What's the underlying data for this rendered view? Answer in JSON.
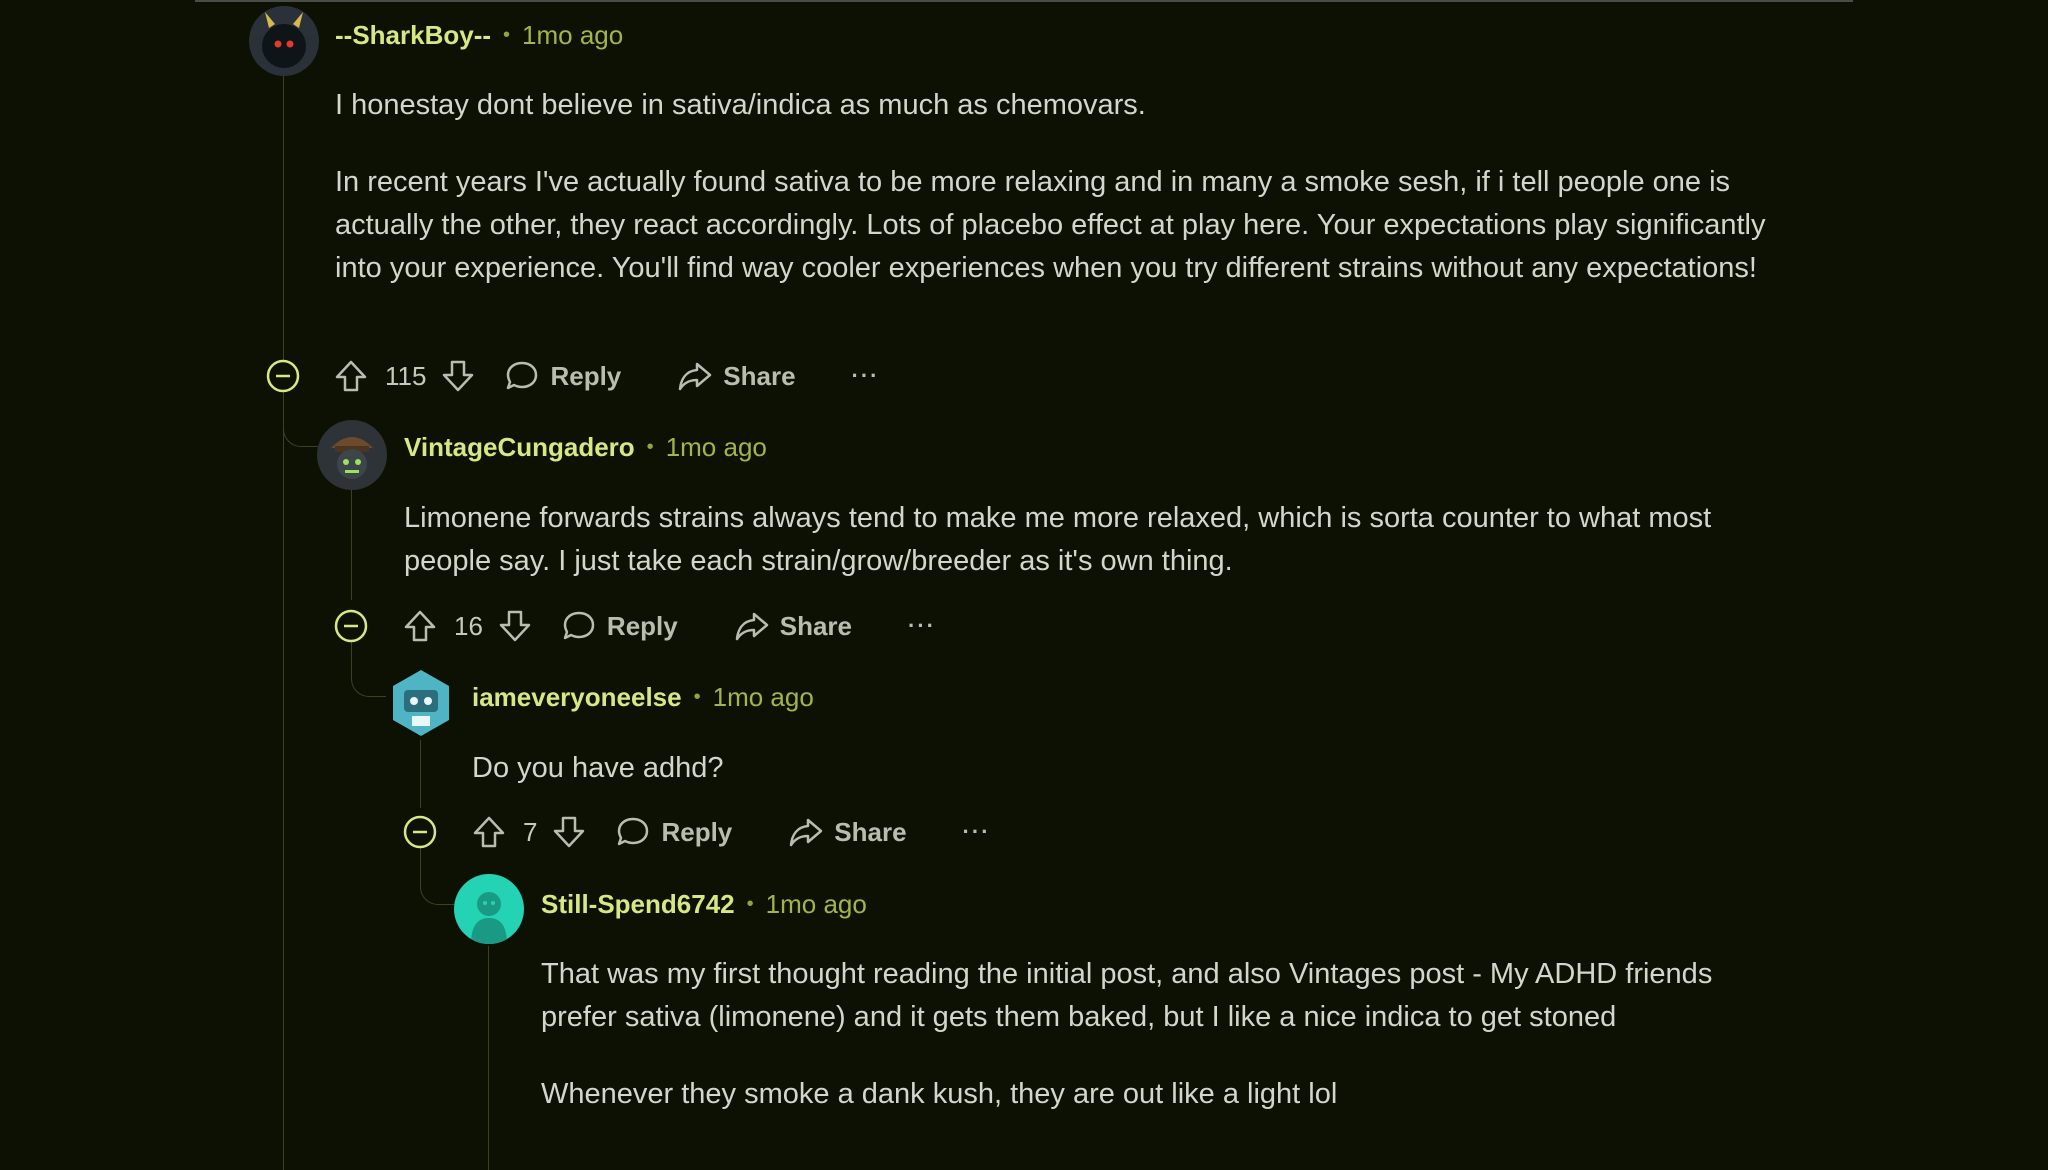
{
  "comments": [
    {
      "username": "--SharkBoy--",
      "time": "1mo ago",
      "paragraphs": [
        "I honestay dont believe in sativa/indica as much as chemovars.",
        "In recent years I've actually found sativa to be more relaxing and in many a smoke sesh, if i tell people one is actually the other, they react accordingly. Lots of placebo effect at play here. Your expectations play significantly into your experience. You'll find way cooler experiences when you try different strains without any expectations!"
      ],
      "score": "115",
      "reply_label": "Reply",
      "share_label": "Share",
      "more_label": "···"
    },
    {
      "username": "VintageCungadero",
      "time": "1mo ago",
      "paragraphs": [
        "Limonene forwards strains always tend to make me more relaxed, which is sorta counter to what most people say. I just take each strain/grow/breeder as it's own thing."
      ],
      "score": "16",
      "reply_label": "Reply",
      "share_label": "Share",
      "more_label": "···"
    },
    {
      "username": "iameveryoneelse",
      "time": "1mo ago",
      "paragraphs": [
        "Do you have adhd?"
      ],
      "score": "7",
      "reply_label": "Reply",
      "share_label": "Share",
      "more_label": "···"
    },
    {
      "username": "Still-Spend6742",
      "time": "1mo ago",
      "paragraphs": [
        "That was my first thought reading the initial post, and also Vintages post - My ADHD friends prefer sativa (limonene) and it gets them baked, but I like a nice indica to get stoned",
        "Whenever they smoke a dank kush, they are out like a light lol"
      ]
    }
  ],
  "separator": "•",
  "colors": {
    "background": "#0c1104",
    "username": "#d4e883",
    "timestamp": "#a2b548",
    "body_text": "#d3d6cd",
    "action_text": "#b8bdb0",
    "thread_line": "#3a4320"
  },
  "icons": [
    "collapse-icon",
    "upvote-icon",
    "downvote-icon",
    "reply-icon",
    "share-icon",
    "more-icon"
  ]
}
